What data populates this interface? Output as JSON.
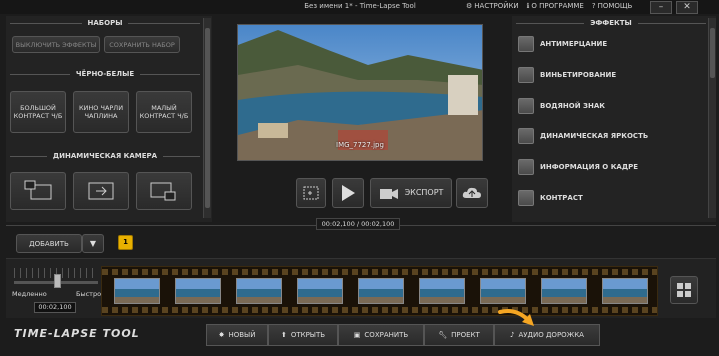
{
  "window": {
    "title": "Без имени 1* - Time-Lapse Tool"
  },
  "topmenu": {
    "settings": "НАСТРОЙКИ",
    "about": "О ПРОГРАММЕ",
    "help": "ПОМОЩЬ"
  },
  "presets": {
    "heading": "НАБОРЫ",
    "disable_effects": "ВЫКЛЮЧИТЬ ЭФФЕКТЫ",
    "save_preset": "СОХРАНИТЬ НАБОР"
  },
  "bw": {
    "heading": "ЧЁРНО-БЕЛЫЕ",
    "items": [
      "БОЛЬШОЙ КОНТРАСТ Ч/Б",
      "КИНО ЧАРЛИ ЧАПЛИНА",
      "МАЛЫЙ КОНТРАСТ Ч/Б"
    ]
  },
  "dyncam": {
    "heading": "ДИНАМИЧЕСКАЯ КАМЕРА"
  },
  "effects": {
    "heading": "ЭФФЕКТЫ",
    "items": [
      "АНТИМЕРЦАНИЕ",
      "ВИНЬЕТИРОВАНИЕ",
      "ВОДЯНОЙ ЗНАК",
      "ДИНАМИЧЕСКАЯ ЯРКОСТЬ",
      "ИНФОРМАЦИЯ О КАДРЕ",
      "КОНТРАСТ"
    ]
  },
  "preview": {
    "filename": "IMG_7727.jpg"
  },
  "playback": {
    "export": "ЭКСПОРТ",
    "time": "00:02,100 / 00:02,100"
  },
  "timeline": {
    "add": "ДОБАВИТЬ",
    "track_number": "1",
    "slow": "Медленно",
    "fast": "Быстро",
    "duration": "00:02,100"
  },
  "logo": "TIME-LAPSE TOOL",
  "toolbar": {
    "new": "НОВЫЙ",
    "open": "ОТКРЫТЬ",
    "save": "СОХРАНИТЬ",
    "project": "ПРОЕКТ",
    "audio": "АУДИО ДОРОЖКА"
  },
  "colors": {
    "accent": "#f5a623",
    "track_badge": "#e8b000"
  }
}
